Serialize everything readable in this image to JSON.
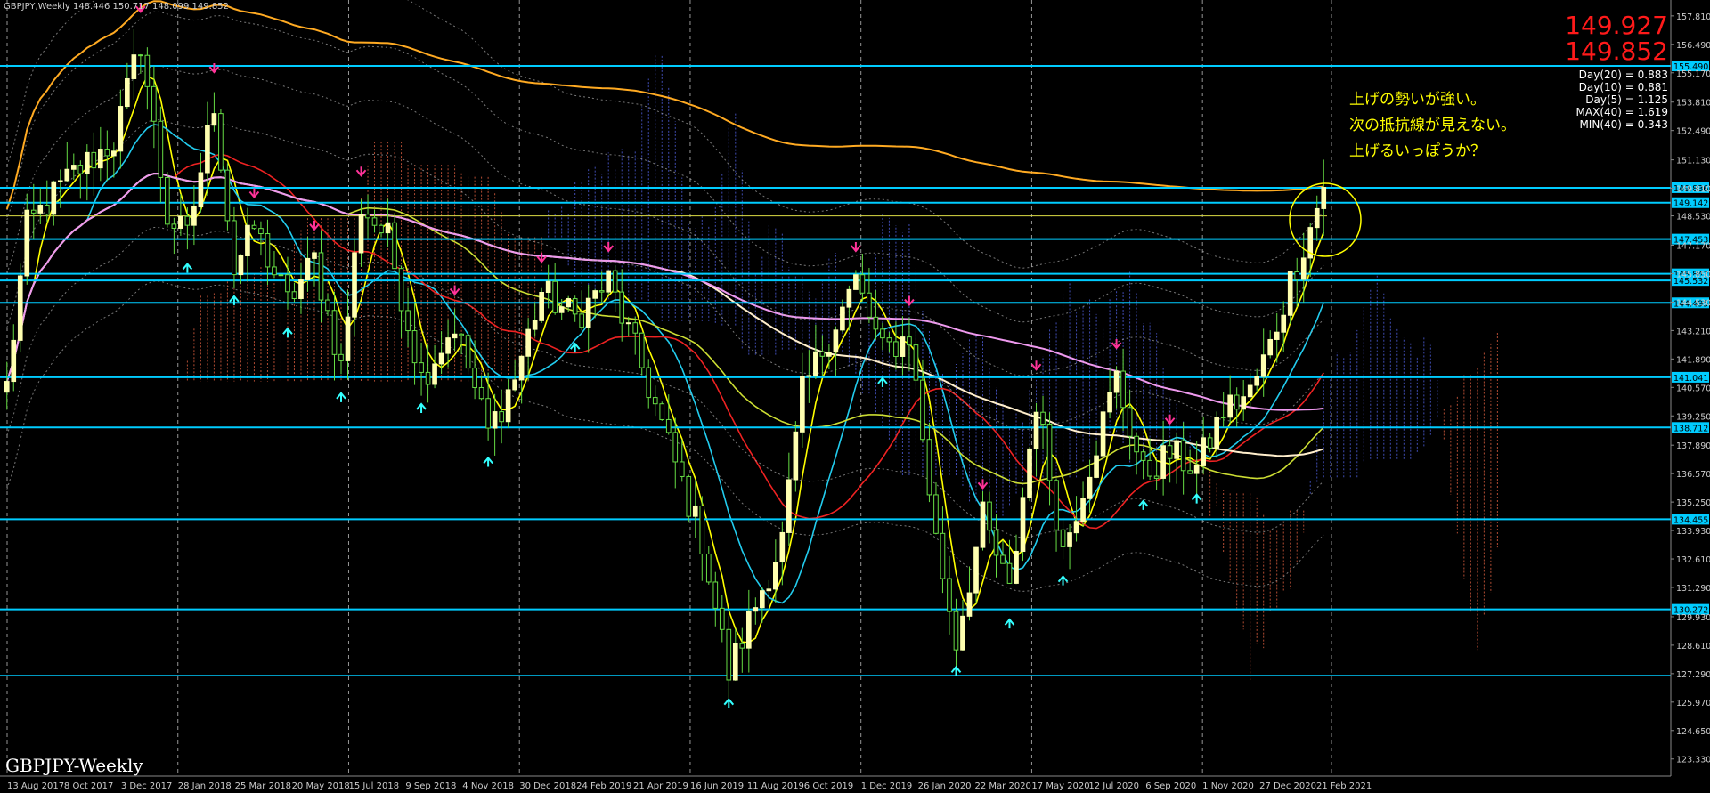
{
  "header": {
    "text": "GBPJPY,Weekly  148.446 150.717 148.099 149.852"
  },
  "symbol_label": "GBPJPY-Weekly",
  "prices": {
    "ask": "149.927",
    "bid": "149.852"
  },
  "stats": [
    "Day(20) = 0.883",
    "Day(10) = 0.881",
    "Day(5) = 1.125",
    "MAX(40) = 1.619",
    "MIN(40) = 0.343"
  ],
  "annotation": [
    "上げの勢いが強い。",
    "次の抵抗線が見えない。",
    "上げるいっぽうか？"
  ],
  "colors": {
    "background": "#000000",
    "candle_up": "#ffffb0",
    "candle_down": "#66dd44",
    "hline": "#00ccff",
    "ask": "#ff1a1a",
    "annotation": "#ffff00",
    "ma_yellow": "#ffff00",
    "ma_cyan": "#22ccee",
    "ma_red": "#ee2222",
    "ma_orange": "#ffaa22",
    "ma_cream": "#ffeecc",
    "ma_violet": "#ee99ee"
  },
  "chart_data": {
    "type": "candlestick",
    "title": "GBPJPY,Weekly",
    "y_ticks": [
      "157.810",
      "156.490",
      "155.170",
      "153.810",
      "152.490",
      "151.130",
      "149.810",
      "148.530",
      "147.170",
      "145.850",
      "144.530",
      "143.210",
      "141.890",
      "140.570",
      "139.250",
      "137.890",
      "136.570",
      "135.250",
      "133.930",
      "132.610",
      "131.290",
      "129.930",
      "128.610",
      "127.290",
      "125.970",
      "124.650",
      "123.330"
    ],
    "ylim": [
      122.7,
      158.3
    ],
    "x_ticks": [
      "13 Aug 2017",
      "8 Oct 2017",
      "3 Dec 2017",
      "28 Jan 2018",
      "25 Mar 2018",
      "20 May 2018",
      "15 Jul 2018",
      "9 Sep 2018",
      "4 Nov 2018",
      "30 Dec 2018",
      "24 Feb 2019",
      "21 Apr 2019",
      "16 Jun 2019",
      "11 Aug 2019",
      "6 Oct 2019",
      "1 Dec 2019",
      "26 Jan 2020",
      "22 Mar 2020",
      "17 May 2020",
      "12 Jul 2020",
      "6 Sep 2020",
      "1 Nov 2020",
      "27 Dec 2020",
      "21 Feb 2021"
    ],
    "horizontal_levels": [
      {
        "value": 155.49,
        "label": "155.490"
      },
      {
        "value": 149.836,
        "label": "149.836"
      },
      {
        "value": 149.142,
        "label": "149.142"
      },
      {
        "value": 147.453,
        "label": "147.453"
      },
      {
        "value": 145.842,
        "label": "145.842"
      },
      {
        "value": 145.532,
        "label": "145.532"
      },
      {
        "value": 144.495,
        "label": "144.495"
      },
      {
        "value": 141.041,
        "label": "141.041"
      },
      {
        "value": 138.712,
        "label": "138.712"
      },
      {
        "value": 134.455,
        "label": "134.455"
      },
      {
        "value": 130.272,
        "label": "130.272"
      },
      {
        "value": 127.2
      }
    ],
    "current_price": 149.852,
    "anchors": [
      {
        "w": 0,
        "p": 140.6
      },
      {
        "w": 3,
        "p": 148.0
      },
      {
        "w": 7,
        "p": 149.5
      },
      {
        "w": 10,
        "p": 150.5
      },
      {
        "w": 16,
        "p": 152.0
      },
      {
        "w": 20,
        "p": 156.6
      },
      {
        "w": 24,
        "p": 148.5
      },
      {
        "w": 27,
        "p": 147.5
      },
      {
        "w": 31,
        "p": 153.8
      },
      {
        "w": 34,
        "p": 146.0
      },
      {
        "w": 37,
        "p": 148.0
      },
      {
        "w": 42,
        "p": 144.5
      },
      {
        "w": 46,
        "p": 146.5
      },
      {
        "w": 50,
        "p": 141.5
      },
      {
        "w": 53,
        "p": 149.0
      },
      {
        "w": 57,
        "p": 147.5
      },
      {
        "w": 62,
        "p": 141.0
      },
      {
        "w": 67,
        "p": 143.5
      },
      {
        "w": 72,
        "p": 138.5
      },
      {
        "w": 76,
        "p": 141.0
      },
      {
        "w": 80,
        "p": 145.0
      },
      {
        "w": 85,
        "p": 143.8
      },
      {
        "w": 90,
        "p": 145.5
      },
      {
        "w": 95,
        "p": 141.5
      },
      {
        "w": 100,
        "p": 137.0
      },
      {
        "w": 104,
        "p": 133.5
      },
      {
        "w": 108,
        "p": 127.3
      },
      {
        "w": 112,
        "p": 130.5
      },
      {
        "w": 116,
        "p": 133.5
      },
      {
        "w": 119,
        "p": 140.3
      },
      {
        "w": 123,
        "p": 143.0
      },
      {
        "w": 127,
        "p": 145.5
      },
      {
        "w": 131,
        "p": 142.2
      },
      {
        "w": 135,
        "p": 143.0
      },
      {
        "w": 139,
        "p": 133.5
      },
      {
        "w": 142,
        "p": 128.8
      },
      {
        "w": 146,
        "p": 134.5
      },
      {
        "w": 150,
        "p": 131.0
      },
      {
        "w": 154,
        "p": 140.0
      },
      {
        "w": 158,
        "p": 133.0
      },
      {
        "w": 162,
        "p": 137.0
      },
      {
        "w": 166,
        "p": 141.0
      },
      {
        "w": 170,
        "p": 136.5
      },
      {
        "w": 174,
        "p": 137.5
      },
      {
        "w": 178,
        "p": 136.8
      },
      {
        "w": 182,
        "p": 139.5
      },
      {
        "w": 186,
        "p": 140.3
      },
      {
        "w": 189,
        "p": 142.5
      },
      {
        "w": 192,
        "p": 145.5
      },
      {
        "w": 195,
        "p": 148.0
      },
      {
        "w": 197,
        "p": 149.85
      }
    ],
    "moving_averages": [
      {
        "color": "#ffff00",
        "period": 5
      },
      {
        "color": "#22ccee",
        "period": 13
      },
      {
        "color": "#ee2222",
        "period": 26
      },
      {
        "color": "#ccdd33",
        "period": 52
      },
      {
        "color": "#ffeecc",
        "period": 100
      },
      {
        "color": "#ee99ee",
        "period": 150
      }
    ]
  }
}
